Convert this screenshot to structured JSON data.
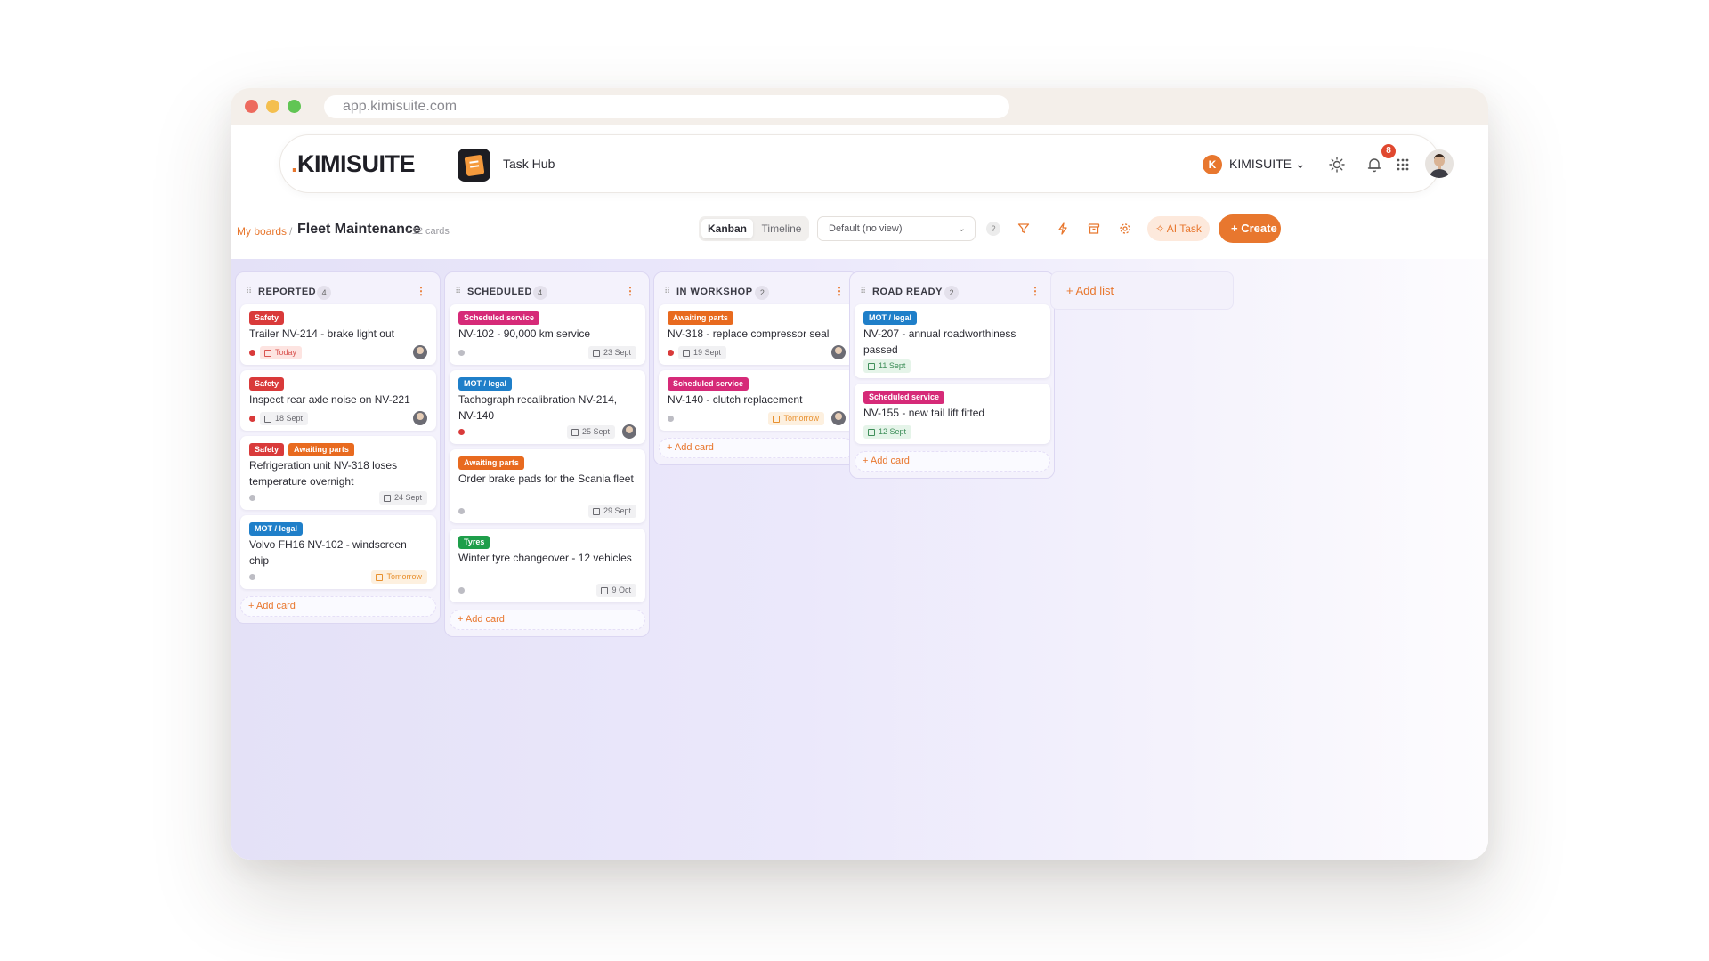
{
  "browser": {
    "url": "app.kimisuite.com"
  },
  "nav": {
    "logo_prefix": ".",
    "logo_text": "KIMISUITE",
    "app_name": "Task Hub",
    "workspace_initial": "K",
    "workspace_name": "KIMISUITE",
    "notification_count": "8"
  },
  "breadcrumb": {
    "root": "My boards",
    "separator": "/",
    "title": "Fleet Maintenance",
    "count": "· 12 cards"
  },
  "toolbar": {
    "views": [
      "Kanban",
      "Timeline"
    ],
    "active_view": "Kanban",
    "view_select": "Default (no view)",
    "help_label": "?",
    "ai_label": "AI Task",
    "create_label": "+ Create"
  },
  "colors": {
    "accent": "#e8772e",
    "safety": "#d93a3a",
    "scheduled_service": "#d62a78",
    "awaiting_parts": "#e86a1f",
    "mot_legal": "#1f7fc9",
    "tyres": "#1e9e4a"
  },
  "columns": [
    {
      "title": "REPORTED",
      "count": "4",
      "add_label": "+ Add card",
      "cards": [
        {
          "tags": [
            {
              "label": "Safety",
              "type": "safety"
            }
          ],
          "title": "Trailer NV-214 - brake light out",
          "priority": "high",
          "date": "Today",
          "date_style": "today",
          "assignee": true
        },
        {
          "tags": [
            {
              "label": "Safety",
              "type": "safety"
            }
          ],
          "title": "Inspect rear axle noise on NV-221",
          "priority": "high",
          "date": "18 Sept",
          "date_style": "normal",
          "assignee": true
        },
        {
          "tags": [
            {
              "label": "Safety",
              "type": "safety"
            },
            {
              "label": "Awaiting parts",
              "type": "awaiting_parts"
            }
          ],
          "title": "Refrigeration unit NV-318 loses temperature overnight",
          "priority": "low",
          "date": "24 Sept",
          "date_style": "normal",
          "assignee": false
        },
        {
          "tags": [
            {
              "label": "MOT / legal",
              "type": "mot_legal"
            }
          ],
          "title": "Volvo FH16 NV-102 - windscreen chip",
          "priority": "low",
          "date": "Tomorrow",
          "date_style": "tomorrow",
          "assignee": false
        }
      ]
    },
    {
      "title": "SCHEDULED",
      "count": "4",
      "add_label": "+ Add card",
      "cards": [
        {
          "tags": [
            {
              "label": "Scheduled service",
              "type": "scheduled_service"
            }
          ],
          "title": "NV-102 - 90,000 km service",
          "priority": "low",
          "date": "23 Sept",
          "date_style": "normal",
          "assignee": false
        },
        {
          "tags": [
            {
              "label": "MOT / legal",
              "type": "mot_legal"
            }
          ],
          "title": "Tachograph recalibration NV-214, NV-140",
          "priority": "high",
          "date": "25 Sept",
          "date_style": "normal",
          "assignee": true
        },
        {
          "tags": [
            {
              "label": "Awaiting parts",
              "type": "awaiting_parts"
            }
          ],
          "title": "Order brake pads for the Scania fleet",
          "priority": "low",
          "date": "29 Sept",
          "date_style": "normal",
          "assignee": false
        },
        {
          "tags": [
            {
              "label": "Tyres",
              "type": "tyres"
            }
          ],
          "title": "Winter tyre changeover - 12 vehicles",
          "priority": "low",
          "date": "9 Oct",
          "date_style": "normal",
          "assignee": false
        }
      ]
    },
    {
      "title": "IN WORKSHOP",
      "count": "2",
      "add_label": "+ Add card",
      "cards": [
        {
          "tags": [
            {
              "label": "Awaiting parts",
              "type": "awaiting_parts"
            }
          ],
          "title": "NV-318 - replace compressor seal",
          "priority": "high",
          "date": "19 Sept",
          "date_style": "normal",
          "assignee": true
        },
        {
          "tags": [
            {
              "label": "Scheduled service",
              "type": "scheduled_service"
            }
          ],
          "title": "NV-140 - clutch replacement",
          "priority": "low",
          "date": "Tomorrow",
          "date_style": "tomorrow",
          "assignee": true
        }
      ]
    },
    {
      "title": "ROAD READY",
      "count": "2",
      "add_label": "+ Add card",
      "cards": [
        {
          "tags": [
            {
              "label": "MOT / legal",
              "type": "mot_legal"
            }
          ],
          "title": "NV-207 - annual roadworthiness passed",
          "priority": "none",
          "date": "11 Sept",
          "date_style": "done",
          "assignee": false
        },
        {
          "tags": [
            {
              "label": "Scheduled service",
              "type": "scheduled_service"
            }
          ],
          "title": "NV-155 - new tail lift fitted",
          "priority": "none",
          "date": "12 Sept",
          "date_style": "done",
          "assignee": false
        }
      ]
    }
  ],
  "add_list_label": "+ Add list"
}
